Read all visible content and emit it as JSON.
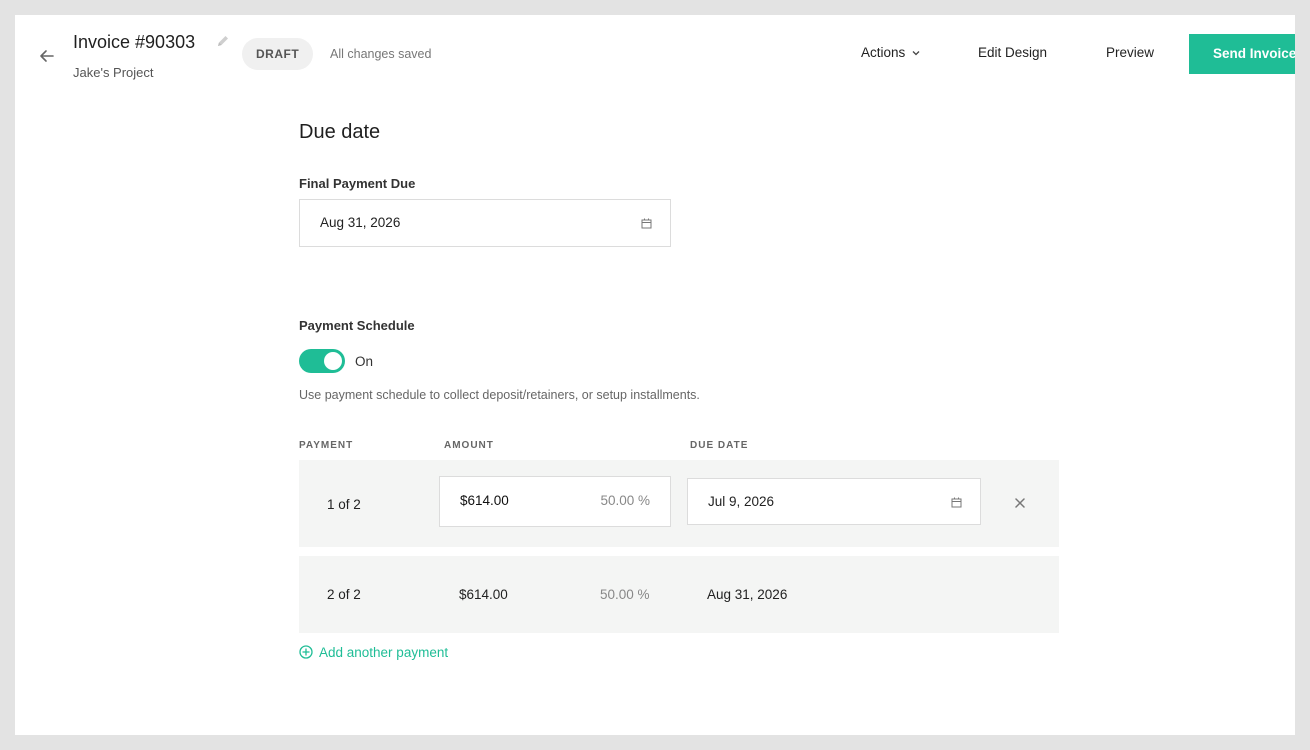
{
  "header": {
    "title": "Invoice #90303",
    "subtitle": "Jake's Project",
    "status_badge": "DRAFT",
    "saved_status": "All changes saved",
    "actions_label": "Actions",
    "edit_design_label": "Edit Design",
    "preview_label": "Preview",
    "send_label": "Send Invoice"
  },
  "due_date": {
    "title": "Due date",
    "final_label": "Final Payment Due",
    "final_value": "Aug 31, 2026"
  },
  "schedule": {
    "label": "Payment Schedule",
    "toggle_state": "On",
    "help_text": "Use payment schedule to collect deposit/retainers, or setup installments.",
    "columns": [
      "PAYMENT",
      "AMOUNT",
      "DUE DATE"
    ],
    "payments": [
      {
        "number": "1 of 2",
        "amount": "$614.00",
        "percent": "50.00 %",
        "due": "Jul 9, 2026",
        "editable": true
      },
      {
        "number": "2 of 2",
        "amount": "$614.00",
        "percent": "50.00 %",
        "due": "Aug 31, 2026",
        "editable": false
      }
    ],
    "add_label": "Add another payment"
  },
  "colors": {
    "accent": "#1fbd96",
    "row_background": "#f4f5f4",
    "badge_background": "#f0f0f0"
  },
  "icons": [
    "arrow-left-icon",
    "pencil-icon",
    "chevron-down-icon",
    "calendar-icon",
    "close-icon",
    "plus-circle-icon"
  ]
}
